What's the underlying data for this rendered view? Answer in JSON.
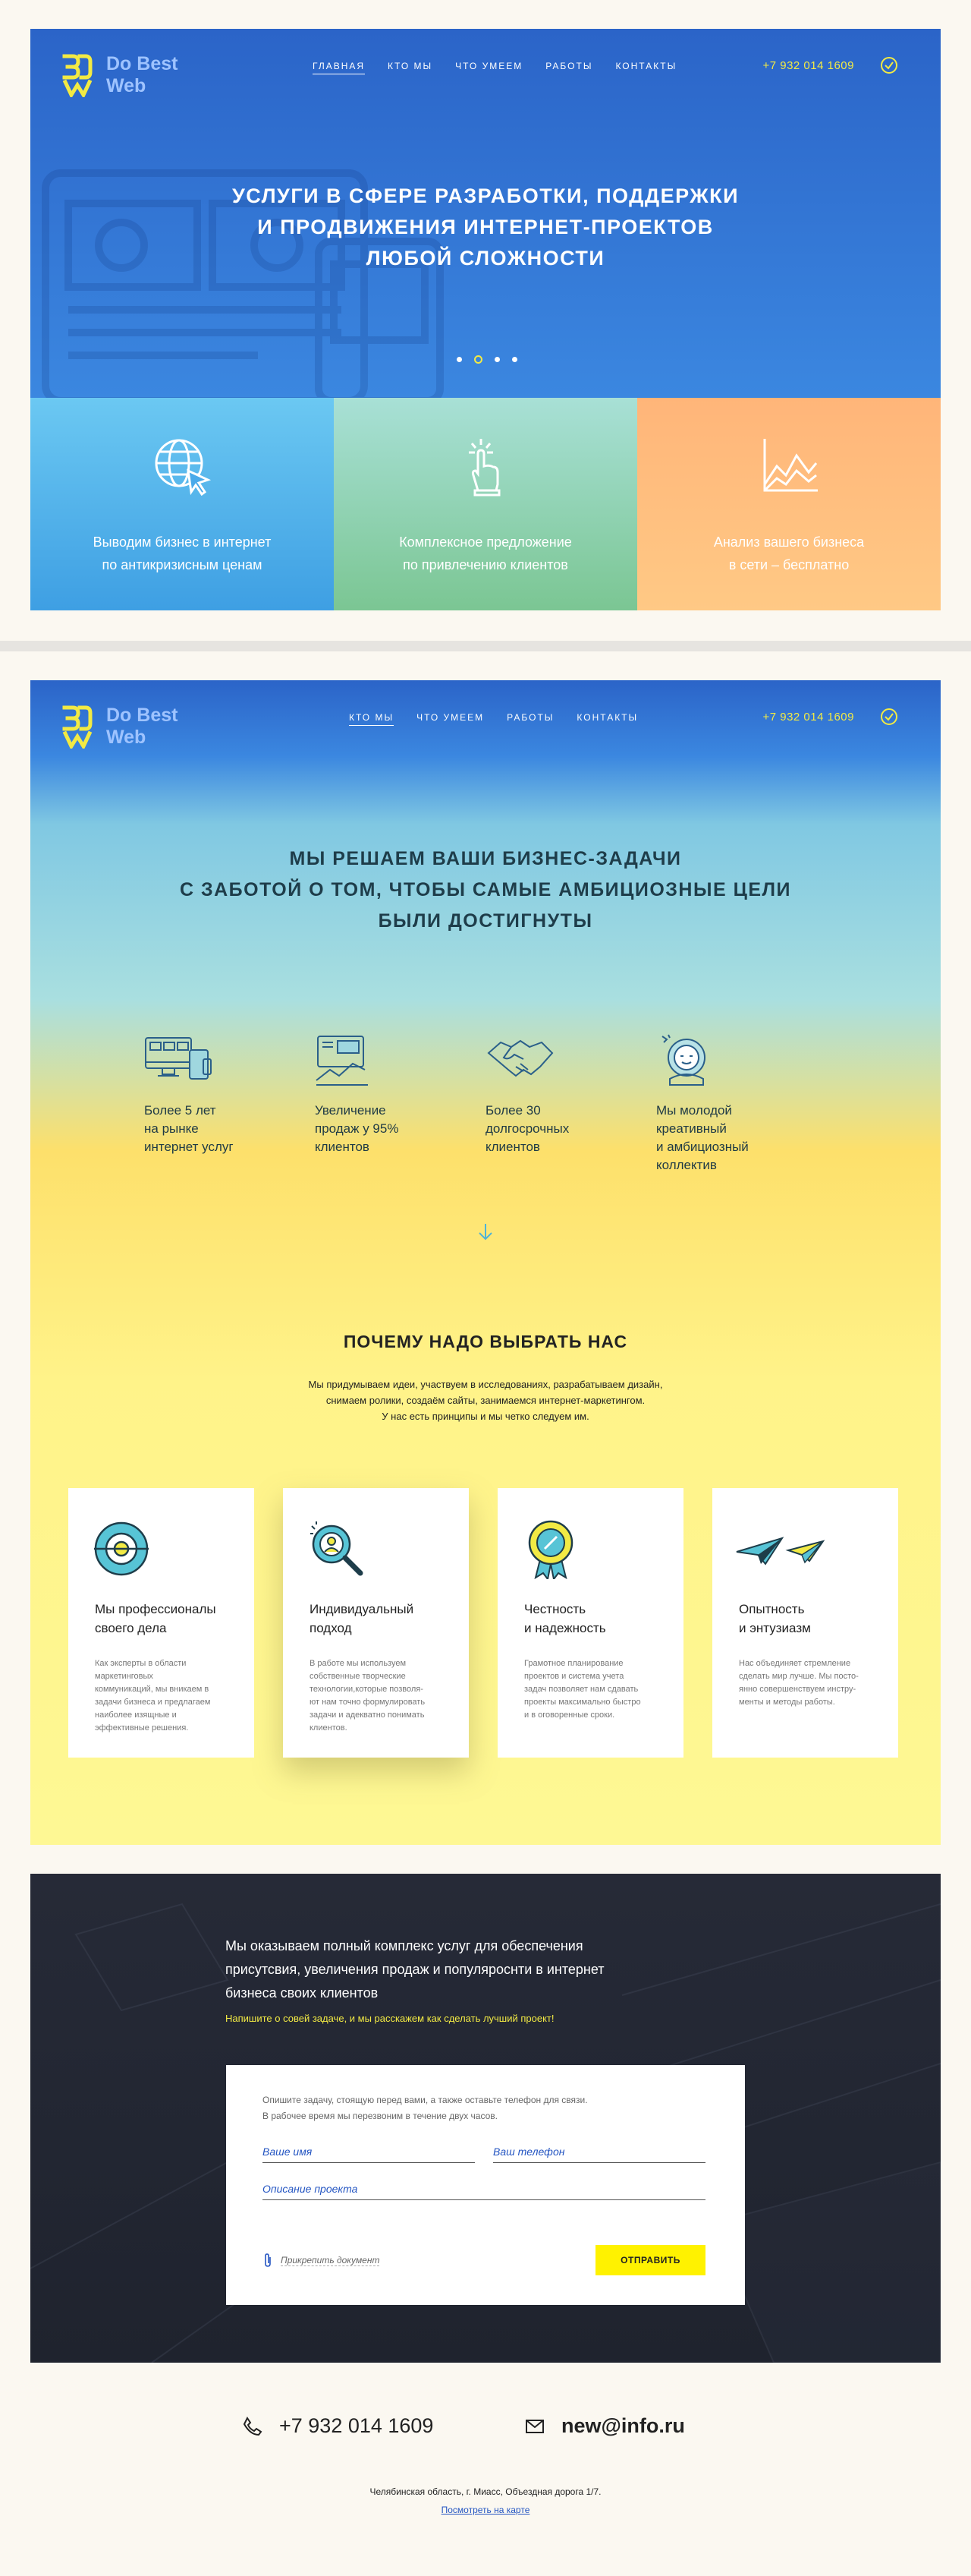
{
  "brand": {
    "name_line1": "Do Best",
    "name_line2": "Web",
    "accent": "#f2ea44",
    "primary": "#2b64c8"
  },
  "hero": {
    "nav": [
      "Главная",
      "Кто мы",
      "Что умеем",
      "Работы",
      "Контакты"
    ],
    "active_nav": "Главная",
    "phone": "+7 932 014 1609",
    "title_lines": [
      "Услуги в сфере разработки, поддержки",
      "и продвижения интернет-проектов",
      "любой сложности"
    ],
    "slides_total": 4,
    "slide_active": 2,
    "tiles": [
      {
        "icon": "globe-cursor-icon",
        "line1": "Выводим бизнес в интернет",
        "line2": "по антикризисным ценам",
        "color": "#4aaaea"
      },
      {
        "icon": "tap-hand-icon",
        "line1": "Комплексное предложение",
        "line2": "по привлечению клиентов",
        "color": "#8fd3b0"
      },
      {
        "icon": "growth-chart-icon",
        "line1": "Анализ вашего бизнеса",
        "line2": "в сети – бесплатно",
        "color": "#ffbe7c"
      }
    ]
  },
  "about": {
    "nav": [
      "Кто мы",
      "Что умеем",
      "Работы",
      "Контакты"
    ],
    "active_nav": "Кто мы",
    "phone": "+7 932 014 1609",
    "title_lines": [
      "Мы решаем ваши бизнес-задачи",
      "с заботой о том, чтобы самые амбициозные цели",
      "были достигнуты"
    ],
    "stats": [
      {
        "icon": "devices-icon",
        "lines": [
          "Более 5 лет",
          "на рынке",
          "интернет услуг"
        ]
      },
      {
        "icon": "sales-chart-icon",
        "lines": [
          "Увеличение",
          "продаж у 95%",
          "клиентов"
        ]
      },
      {
        "icon": "handshake-icon",
        "lines": [
          "Более 30",
          "долгосрочных",
          "клиентов"
        ]
      },
      {
        "icon": "astronaut-icon",
        "lines": [
          "Мы молодой",
          "креативный",
          "и амбициозный",
          "коллектив"
        ]
      }
    ],
    "why_title": "Почему надо выбрать нас",
    "why_lines": [
      "Мы придумываем идеи, участвуем в исследованиях, разрабатываем дизайн,",
      "снимаем ролики, создаём сайты, занимаемся интернет-маркетингом.",
      "У нас есть принципы и мы четко следуем им."
    ],
    "cards": [
      {
        "icon": "target-gear-icon",
        "title_lines": [
          "Мы профессионалы",
          "своего дела"
        ],
        "text_lines": [
          "Как эксперты в области",
          "маркетинговых",
          "коммуникаций, мы вникаем в",
          "задачи бизнеса и предлагаем",
          "наиболее изящные и",
          "эффективные решения."
        ]
      },
      {
        "icon": "magnifier-person-icon",
        "title_lines": [
          "Индивидуальный",
          "подход"
        ],
        "text_lines": [
          "В работе мы используем",
          "собственные творческие",
          "технологии,которые позволя-",
          "ют нам точно формулировать",
          "задачи и адекватно понимать",
          "клиентов."
        ]
      },
      {
        "icon": "award-medal-icon",
        "title_lines": [
          "Честность",
          "и надежность"
        ],
        "text_lines": [
          "Грамотное планирование",
          "проектов и система учета",
          "задач позволяет нам сдавать",
          "проекты максимально быстро",
          "и в оговоренные сроки."
        ]
      },
      {
        "icon": "paper-planes-icon",
        "title_lines": [
          "Опытность",
          "и энтузиазм"
        ],
        "text_lines": [
          "Нас объединяет стремление",
          "сделать мир лучше. Мы посто-",
          "янно совершенствуем инстру-",
          "менты и методы работы."
        ]
      }
    ]
  },
  "contact": {
    "title_lines": [
      "Мы оказываем полный комплекс услуг для обеспечения",
      "присутсвия, увеличения продаж и популяроснти в интернет",
      "бизнеса своих клиентов"
    ],
    "subtitle": "Напишите о совей задаче, и мы расскажем как сделать лучший проект!",
    "form": {
      "note_lines": [
        "Опишите задачу, стоящую перед вами, а также оставьте телефон для связи.",
        "В рабочее время мы перезвоним в течение двух часов."
      ],
      "name_placeholder": "Ваше имя",
      "phone_placeholder": "Ваш телефон",
      "description_placeholder": "Описание проекта",
      "attach_label": "Прикрепить документ",
      "submit_label": "Отправить"
    }
  },
  "footer": {
    "phone": "+7 932 014 1609",
    "email": "new@info.ru",
    "address": "Челябинская область, г. Миасс, Объездная дорога 1/7.",
    "map_link": "Посмотреть на карте"
  }
}
